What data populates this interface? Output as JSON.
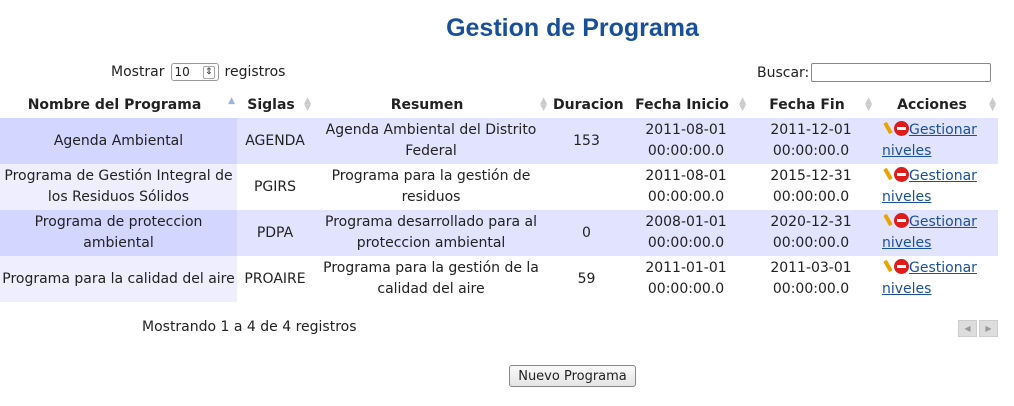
{
  "page": {
    "title": "Gestion de Programa"
  },
  "length": {
    "prefix": "Mostrar",
    "value": "10",
    "suffix": "registros"
  },
  "search": {
    "label": "Buscar:",
    "value": ""
  },
  "table": {
    "headers": [
      "Nombre del Programa",
      "Siglas",
      "Resumen",
      "Duracion",
      "Fecha Inicio",
      "Fecha Fin",
      "Acciones"
    ],
    "rows": [
      {
        "nombre": "Agenda Ambiental",
        "siglas": "AGENDA",
        "resumen": "Agenda Ambiental del Distrito Federal",
        "duracion": "153",
        "inicio": "2011-08-01 00:00:00.0",
        "fin": "2011-12-01 00:00:00.0",
        "link": "Gestionar niveles"
      },
      {
        "nombre": "Programa de Gestión Integral de los Residuos Sólidos",
        "siglas": "PGIRS",
        "resumen": "Programa para la gestión de residuos",
        "duracion": "",
        "inicio": "2011-08-01 00:00:00.0",
        "fin": "2015-12-31 00:00:00.0",
        "link": "Gestionar niveles"
      },
      {
        "nombre": "Programa de proteccion ambiental",
        "siglas": "PDPA",
        "resumen": "Programa desarrollado para al proteccion ambiental",
        "duracion": "0",
        "inicio": "2008-01-01 00:00:00.0",
        "fin": "2020-12-31 00:00:00.0",
        "link": "Gestionar niveles"
      },
      {
        "nombre": "Programa para la calidad del aire",
        "siglas": "PROAIRE",
        "resumen": "Programa para la gestión de la calidad del aire",
        "duracion": "59",
        "inicio": "2011-01-01 00:00:00.0",
        "fin": "2011-03-01 00:00:00.0",
        "link": "Gestionar niveles"
      }
    ]
  },
  "info": "Mostrando 1 a 4 de 4 registros",
  "buttons": {
    "nuevo": "Nuevo Programa"
  },
  "icons": {
    "edit": "pencil-icon",
    "delete": "delete-icon",
    "prev": "prev-page-icon",
    "next": "next-page-icon"
  }
}
